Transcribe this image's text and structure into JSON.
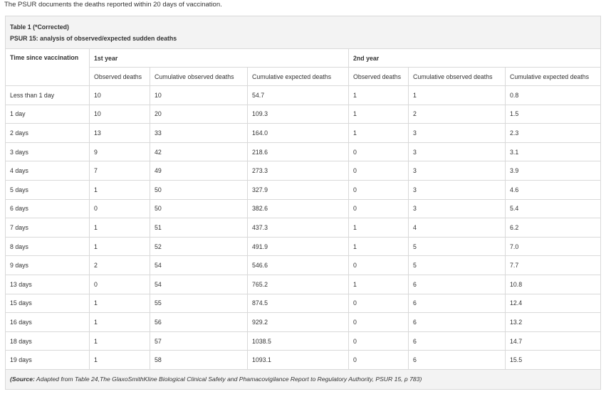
{
  "intro_text": "The PSUR documents the deaths reported within 20 days of vaccination.",
  "table": {
    "caption_line1": "Table 1 (*Corrected)",
    "caption_line2": "PSUR 15: analysis of observed/expected sudden deaths",
    "row_header_label": "Time since vaccination",
    "group_labels": [
      "1st year",
      "2nd year"
    ],
    "sub_headers": [
      "Observed deaths",
      "Cumulative observed deaths",
      "Cumulative expected deaths",
      "Observed deaths",
      "Cumulative observed deaths",
      "Cumulative expected deaths"
    ],
    "rows": [
      [
        "Less than 1 day",
        "10",
        "10",
        "54.7",
        "1",
        "1",
        "0.8"
      ],
      [
        "1 day",
        "10",
        "20",
        "109.3",
        "1",
        "2",
        "1.5"
      ],
      [
        "2 days",
        "13",
        "33",
        "164.0",
        "1",
        "3",
        "2.3"
      ],
      [
        "3 days",
        "9",
        "42",
        "218.6",
        "0",
        "3",
        "3.1"
      ],
      [
        "4 days",
        "7",
        "49",
        "273.3",
        "0",
        "3",
        "3.9"
      ],
      [
        "5 days",
        "1",
        "50",
        "327.9",
        "0",
        "3",
        "4.6"
      ],
      [
        "6 days",
        "0",
        "50",
        "382.6",
        "0",
        "3",
        "5.4"
      ],
      [
        "7 days",
        "1",
        "51",
        "437.3",
        "1",
        "4",
        "6.2"
      ],
      [
        "8 days",
        "1",
        "52",
        "491.9",
        "1",
        "5",
        "7.0"
      ],
      [
        "9 days",
        "2",
        "54",
        "546.6",
        "0",
        "5",
        "7.7"
      ],
      [
        "13 days",
        "0",
        "54",
        "765.2",
        "1",
        "6",
        "10.8"
      ],
      [
        "15 days",
        "1",
        "55",
        "874.5",
        "0",
        "6",
        "12.4"
      ],
      [
        "16 days",
        "1",
        "56",
        "929.2",
        "0",
        "6",
        "13.2"
      ],
      [
        "18 days",
        "1",
        "57",
        "1038.5",
        "0",
        "6",
        "14.7"
      ],
      [
        "19 days",
        "1",
        "58",
        "1093.1",
        "0",
        "6",
        "15.5"
      ]
    ],
    "source_prefix": "(Source:",
    "source_text": " Adapted from Table 24,The GlaxoSmithKline Biological Clinical Safety and Phamacovigilance Report to Regulatory Authority, PSUR 15, p 783)"
  }
}
